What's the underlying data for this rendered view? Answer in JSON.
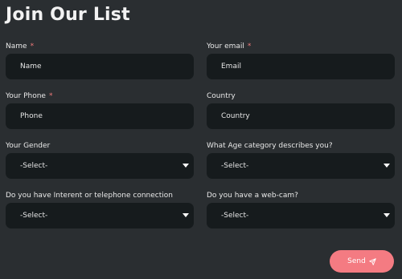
{
  "page": {
    "title": "Join Our List"
  },
  "form": {
    "name": {
      "label": "Name",
      "required_mark": "*",
      "placeholder": "Name"
    },
    "email": {
      "label": "Your email",
      "required_mark": "*",
      "placeholder": "Email"
    },
    "phone": {
      "label": "Your Phone",
      "required_mark": "*",
      "placeholder": "Phone"
    },
    "country": {
      "label": "Country",
      "placeholder": "Country"
    },
    "gender": {
      "label": "Your Gender",
      "value": "-Select-"
    },
    "age": {
      "label": "What Age category describes you?",
      "value": "-Select-"
    },
    "internet": {
      "label": "Do you have Interent or telephone connection",
      "value": "-Select-"
    },
    "webcam": {
      "label": "Do you have a web-cam?",
      "value": "-Select-"
    }
  },
  "actions": {
    "send_label": "Send",
    "send_icon": "paper-plane-icon"
  },
  "colors": {
    "background": "#2a2e31",
    "field": "#161b1d",
    "accent": "#f47b82",
    "required": "#f07a7a"
  }
}
